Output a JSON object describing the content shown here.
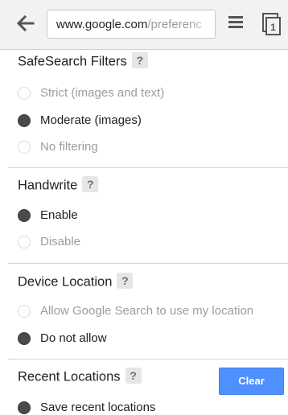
{
  "browser": {
    "url_host": "www.google.com",
    "url_path": "/preferenc"
  },
  "safesearch": {
    "title": "SafeSearch Filters",
    "help": "?",
    "options": [
      {
        "label": "Strict (images and text)",
        "selected": false
      },
      {
        "label": "Moderate (images)",
        "selected": true
      },
      {
        "label": "No filtering",
        "selected": false
      }
    ]
  },
  "handwrite": {
    "title": "Handwrite",
    "help": "?",
    "options": [
      {
        "label": "Enable",
        "selected": true
      },
      {
        "label": "Disable",
        "selected": false
      }
    ]
  },
  "location": {
    "title": "Device Location",
    "help": "?",
    "options": [
      {
        "label": "Allow Google Search to use my location",
        "selected": false
      },
      {
        "label": "Do not allow",
        "selected": true
      }
    ]
  },
  "recent": {
    "title": "Recent Locations",
    "help": "?",
    "clear_label": "Clear",
    "options": [
      {
        "label": "Save recent locations",
        "selected": true
      }
    ]
  },
  "colors": {
    "accent": "#4d90fe",
    "selected_radio": "#4a4a4a",
    "unselected_text": "#9d9d9d"
  }
}
